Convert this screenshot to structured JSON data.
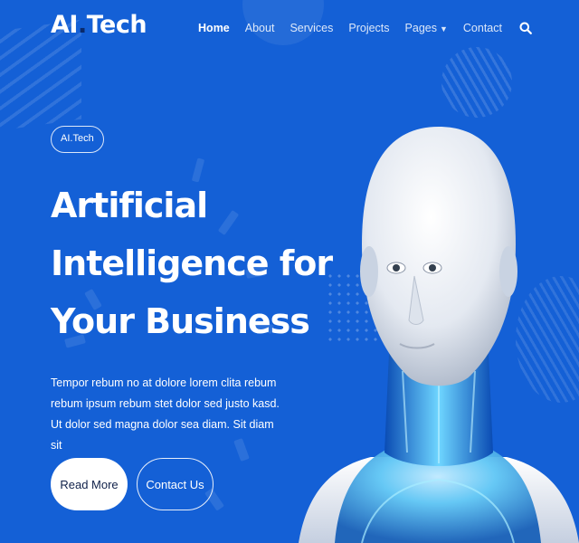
{
  "brand": {
    "logo_main": "AI",
    "logo_dot": ".",
    "logo_rest": "Tech"
  },
  "nav": {
    "items": [
      {
        "label": "Home"
      },
      {
        "label": "About"
      },
      {
        "label": "Services"
      },
      {
        "label": "Projects"
      },
      {
        "label": "Pages"
      },
      {
        "label": "Contact"
      }
    ],
    "active": "Home",
    "search_icon": "search-icon",
    "pages_caret": "chevron-down-icon"
  },
  "hero": {
    "badge": "AI.Tech",
    "headline_lines": [
      "Artificial",
      "Intelligence for",
      "Your Business"
    ],
    "description": "Tempor rebum no at dolore lorem clita rebum rebum ipsum rebum stet dolor sed justo kasd. Ut dolor sed magna dolor sea diam. Sit diam sit",
    "primary_button": "Read More",
    "secondary_button": "Contact Us"
  },
  "colors": {
    "background": "#1460d6",
    "text": "#ffffff",
    "button_primary_bg": "#ffffff",
    "button_primary_text": "#10214a"
  },
  "image": {
    "name": "humanoid-robot-image"
  }
}
